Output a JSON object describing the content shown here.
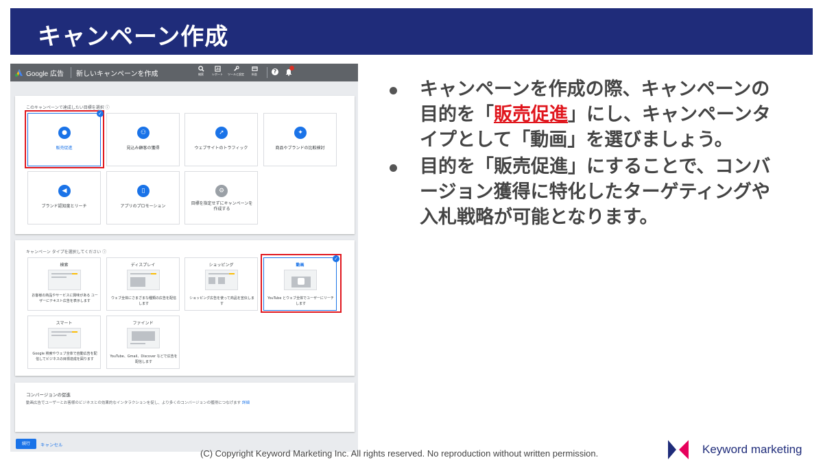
{
  "slide": {
    "title": "キャンペーン作成",
    "copyright": "(C) Copyright Keyword Marketing Inc. All rights reserved. No reproduction without written permission.",
    "logo_text": "Keyword marketing",
    "colors": {
      "title_bar": "#1f2c7a",
      "highlight": "#e0161d",
      "accent": "#1a73e8"
    }
  },
  "ads_header": {
    "brand": "Google 広告",
    "page_title": "新しいキャンペーンを作成",
    "tools": [
      {
        "label": "検索",
        "icon": "search-icon"
      },
      {
        "label": "レポート",
        "icon": "report-icon"
      },
      {
        "label": "ツールと設定",
        "icon": "wrench-icon"
      },
      {
        "label": "料金",
        "icon": "billing-icon"
      }
    ],
    "help_icon": "help-icon",
    "bell_icon": "bell-icon"
  },
  "goal_section": {
    "label": "このキャンペーンで達成したい目標を選択",
    "tiles": [
      {
        "label": "販売促進",
        "icon": "tag-icon",
        "selected": true
      },
      {
        "label": "見込み顧客の獲得",
        "icon": "people-icon"
      },
      {
        "label": "ウェブサイトのトラフィック",
        "icon": "cursor-icon"
      },
      {
        "label": "商品やブランドの比較検討",
        "icon": "sparkle-icon"
      },
      {
        "label": "ブランド認知度とリーチ",
        "icon": "speaker-icon"
      },
      {
        "label": "アプリのプロモーション",
        "icon": "phone-icon"
      },
      {
        "label": "目標を指定せずにキャンペーンを作成する",
        "icon": "gear-icon"
      }
    ]
  },
  "type_section": {
    "label": "キャンペーン タイプを選択してください",
    "tiles": [
      {
        "title": "検索",
        "desc": "お客様の商品やサービスに興味がある ユーザーにテキスト広告を表示します"
      },
      {
        "title": "ディスプレイ",
        "desc": "ウェブ全体にさまざまな種類の広告を配信します"
      },
      {
        "title": "ショッピング",
        "desc": "ショッピング広告を使って商品を宣伝します"
      },
      {
        "title": "動画",
        "desc": "YouTube とウェブ全体でユーザーにリーチします",
        "selected": true
      },
      {
        "title": "スマート",
        "desc": "Google 検索やウェブ全体で自動広告を配信してビジネスの目標達成を図ります"
      },
      {
        "title": "ファインド",
        "desc": "YouTube、Gmail、Discover などで広告を配信します"
      }
    ]
  },
  "conversion": {
    "title": "コンバージョンの促進",
    "desc": "動画広告でユーザーとお客様のビジネスとの効果的なインタラクションを促し、より多くのコンバージョンの獲得につなげます",
    "link": "詳細"
  },
  "actions": {
    "next": "続行",
    "cancel": "キャンセル"
  },
  "bullets": {
    "b1_pre": "キャンペーンを作成の際、キャンペーンの目的を「",
    "b1_em": "販売促進",
    "b1_post": "」にし、キャンペーンタイプとして「動画」を選びましょう。",
    "b2": "目的を「販売促進」にすることで、コンバージョン獲得に特化したターゲティングや入札戦略が可能となります。"
  }
}
